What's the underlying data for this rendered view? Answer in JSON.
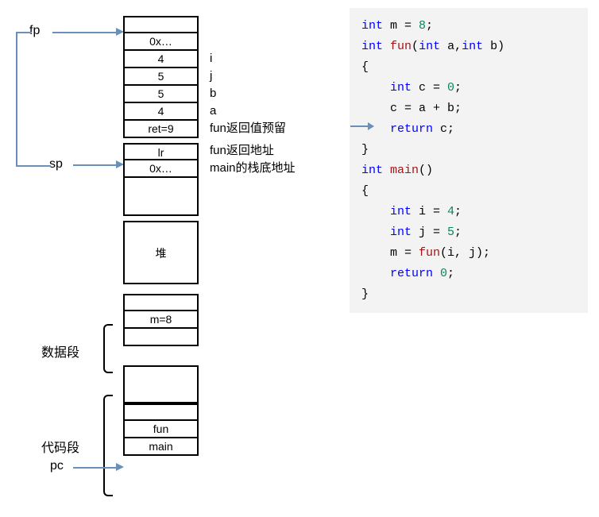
{
  "labels": {
    "fp": "fp",
    "sp": "sp",
    "data_seg": "数据段",
    "code_seg": "代码段",
    "pc": "pc"
  },
  "cells": {
    "c0": "0x…",
    "c1": "4",
    "c2": "5",
    "c3": "5",
    "c4": "4",
    "c5": "ret=9",
    "c6": "lr",
    "c7": "0x…",
    "heap": "堆",
    "data1": "m=8",
    "fun": "fun",
    "main": "main"
  },
  "annos": {
    "i": "i",
    "j": "j",
    "b": "b",
    "a": "a",
    "ret": "fun返回值预留",
    "lr": "fun返回地址",
    "spv": "main的栈底地址"
  },
  "code": {
    "l1a": "int",
    "l1b": " m = ",
    "l1c": "8",
    "l1d": ";",
    "l2a": "int",
    "l2b": " ",
    "l2c": "fun",
    "l2d": "(",
    "l2e": "int",
    "l2f": " a,",
    "l2g": "int",
    "l2h": " b)",
    "l3": "{",
    "l4a": "    int",
    "l4b": " c = ",
    "l4c": "0",
    "l4d": ";",
    "l5a": "    c = a + b;",
    "l6a": "    return",
    "l6b": " c;",
    "l7": "}",
    "l8a": "int",
    "l8b": " ",
    "l8c": "main",
    "l8d": "()",
    "l9": "{",
    "l10a": "    int",
    "l10b": " i = ",
    "l10c": "4",
    "l10d": ";",
    "l11a": "    int",
    "l11b": " j = ",
    "l11c": "5",
    "l11d": ";",
    "l12a": "    m = ",
    "l12b": "fun",
    "l12c": "(i, j);",
    "l13a": "    return",
    "l13b": " ",
    "l13c": "0",
    "l13d": ";",
    "l14": "}"
  }
}
